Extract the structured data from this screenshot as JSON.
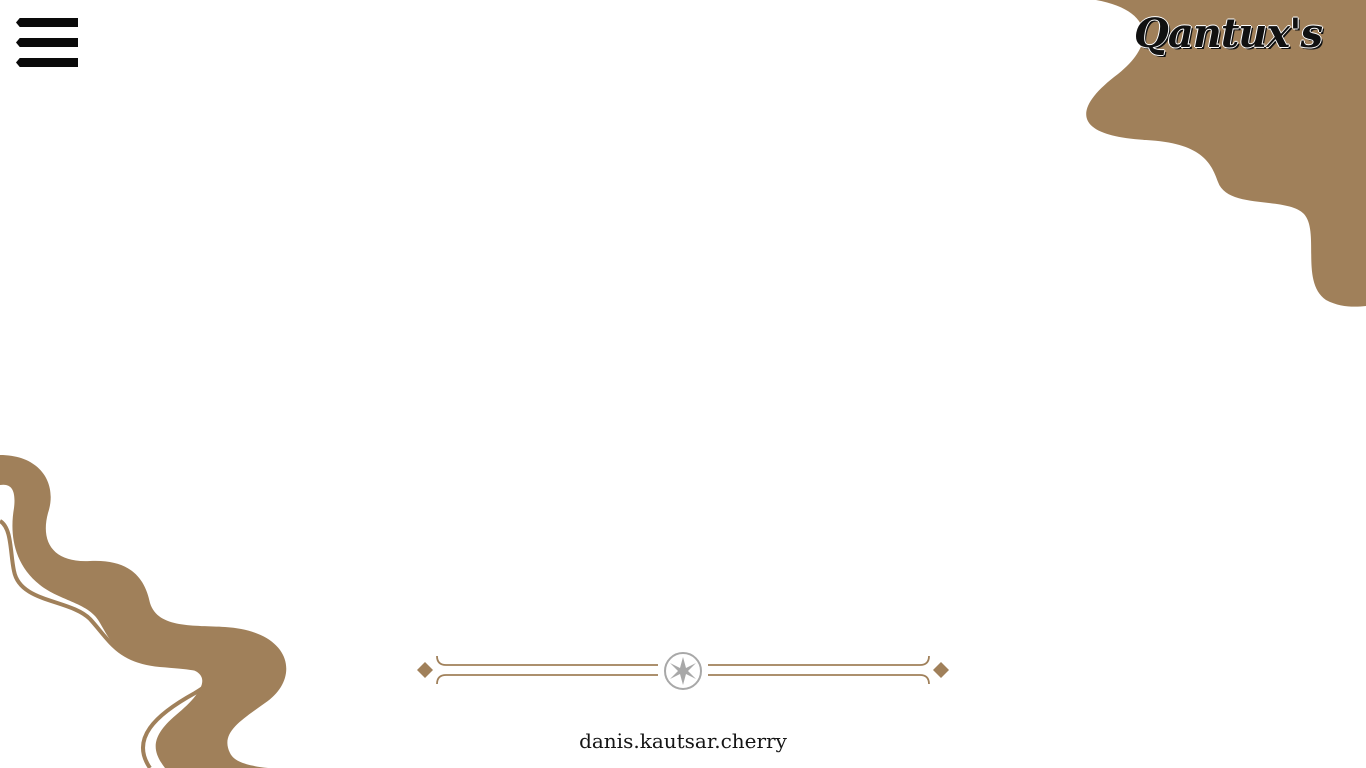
{
  "header": {
    "brand": "Qantux's",
    "menu_icon": "hamburger-menu-icon"
  },
  "decorations": {
    "accent_color": "#a0805a",
    "ornament_icon": "star-divider-icon"
  },
  "footer": {
    "credit": "danis.kautsar.cherry"
  }
}
